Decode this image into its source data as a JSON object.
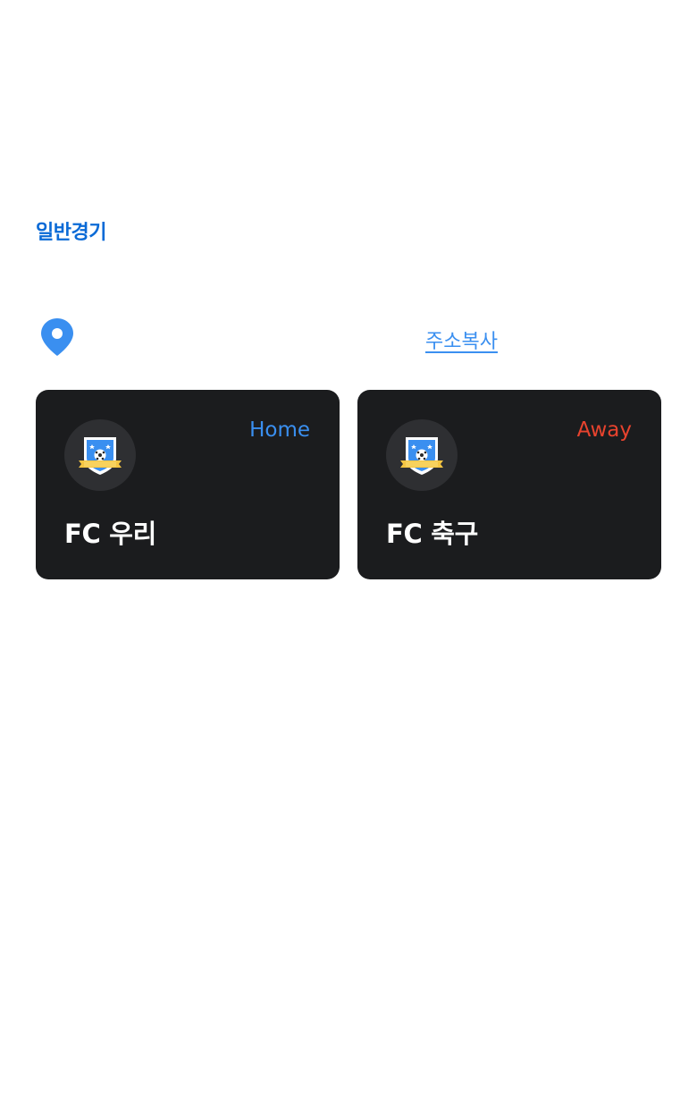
{
  "match": {
    "type_label": "일반경기"
  },
  "location": {
    "pin_icon": "map-pin-icon",
    "copy_label": "주소복사",
    "accent_color": "#3a8ff0"
  },
  "teams": {
    "home": {
      "side_label": "Home",
      "name": "FC 우리",
      "emblem_icon": "team-emblem-icon",
      "side_color": "#3a8ff0"
    },
    "away": {
      "side_label": "Away",
      "name": "FC 축구",
      "emblem_icon": "team-emblem-icon",
      "side_color": "#e8432e"
    }
  },
  "colors": {
    "title": "#0a6ad6",
    "card_background": "#1b1c1e"
  }
}
